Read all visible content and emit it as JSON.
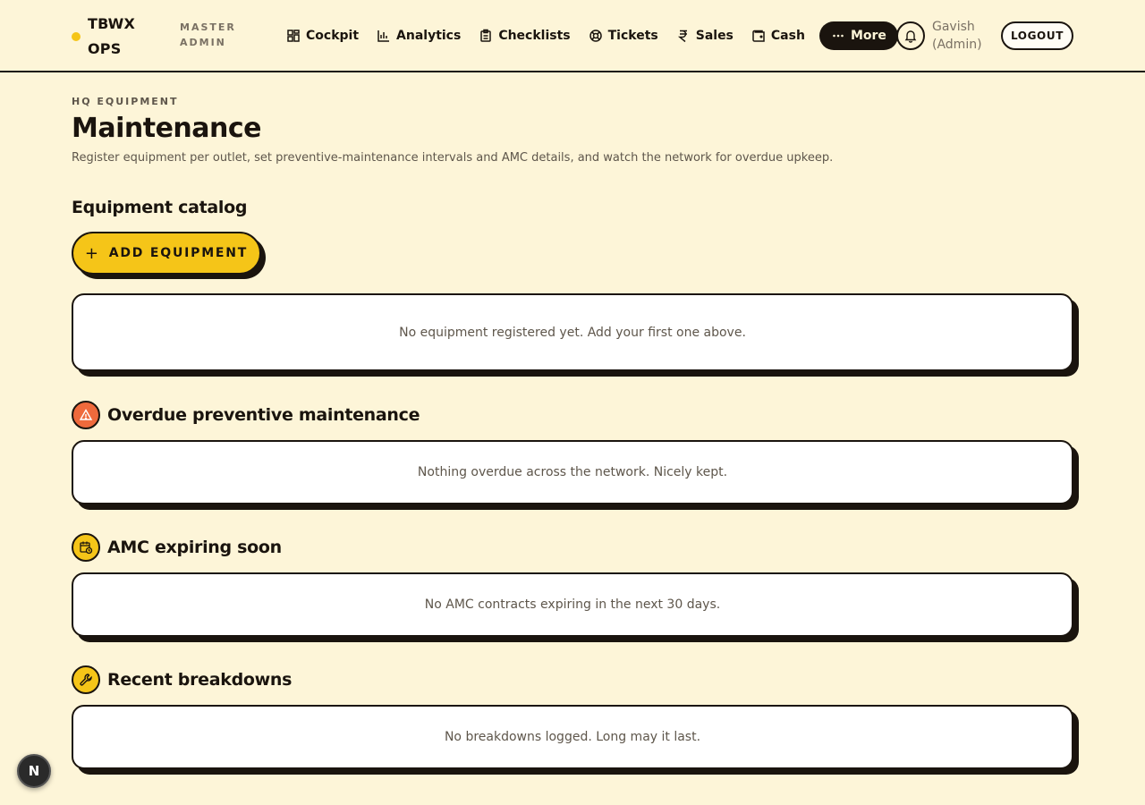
{
  "brand": {
    "name": "TBWX OPS",
    "role": "MASTER ADMIN"
  },
  "nav": [
    {
      "label": "Cockpit",
      "icon": "grid-icon"
    },
    {
      "label": "Analytics",
      "icon": "bar-chart-icon"
    },
    {
      "label": "Checklists",
      "icon": "clipboard-icon"
    },
    {
      "label": "Tickets",
      "icon": "lifebuoy-icon"
    },
    {
      "label": "Sales",
      "icon": "rupee-icon"
    },
    {
      "label": "Cash",
      "icon": "wallet-icon"
    },
    {
      "label": "More",
      "icon": "dots-icon"
    }
  ],
  "user": {
    "name": "Gavish",
    "role": "(Admin)"
  },
  "header": {
    "logout_label": "LOGOUT"
  },
  "page": {
    "eyebrow": "HQ EQUIPMENT",
    "title": "Maintenance",
    "description": "Register equipment per outlet, set preventive-maintenance intervals and AMC details, and watch the network for overdue upkeep."
  },
  "catalog": {
    "title": "Equipment catalog",
    "add_label": "ADD EQUIPMENT",
    "empty": "No equipment registered yet. Add your first one above."
  },
  "overdue": {
    "title": "Overdue preventive maintenance",
    "empty": "Nothing overdue across the network. Nicely kept."
  },
  "amc": {
    "title": "AMC expiring soon",
    "empty": "No AMC contracts expiring in the next 30 days."
  },
  "breakdowns": {
    "title": "Recent breakdowns",
    "empty": "No breakdowns logged. Long may it last."
  },
  "fab": {
    "label": "N"
  },
  "colors": {
    "background": "#fdf5d8",
    "accent": "#f5c518",
    "danger": "#ef6a3c",
    "ink": "#1a140e"
  }
}
